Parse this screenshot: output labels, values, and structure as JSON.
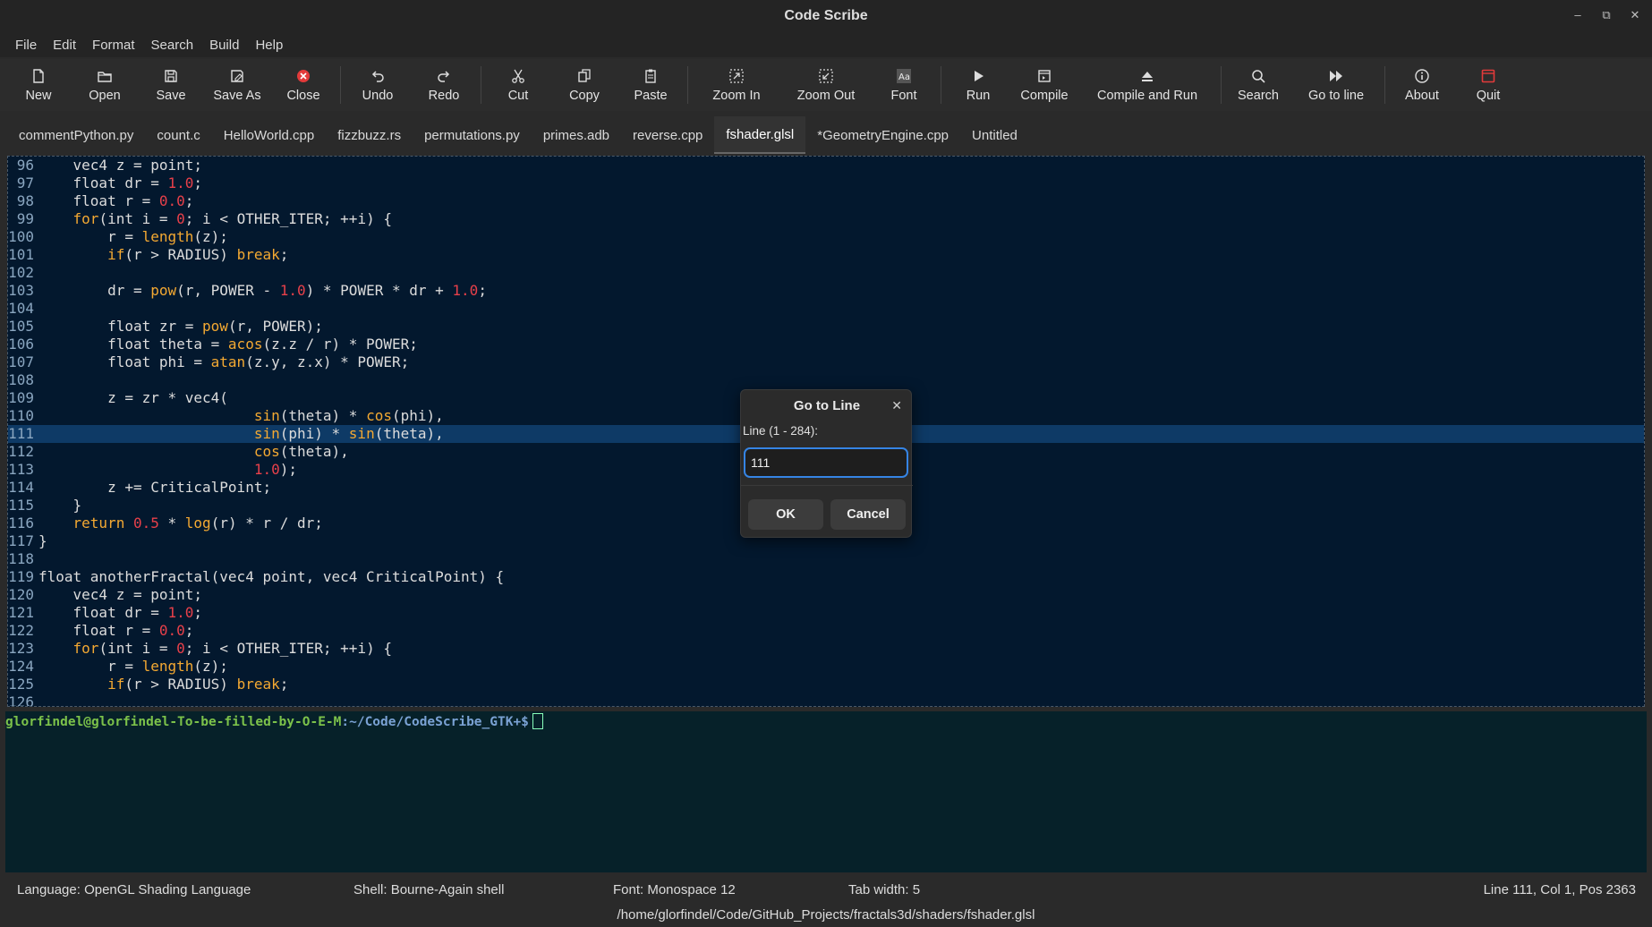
{
  "window": {
    "title": "Code Scribe"
  },
  "menu": [
    "File",
    "Edit",
    "Format",
    "Search",
    "Build",
    "Help"
  ],
  "toolbar": [
    {
      "label": "New",
      "icon": "new-file-icon"
    },
    {
      "label": "Open",
      "icon": "folder-icon"
    },
    {
      "label": "Save",
      "icon": "save-icon"
    },
    {
      "label": "Save As",
      "icon": "save-as-icon"
    },
    {
      "label": "Close",
      "icon": "close-circle-icon"
    },
    {
      "label": "Undo",
      "icon": "undo-icon"
    },
    {
      "label": "Redo",
      "icon": "redo-icon"
    },
    {
      "label": "Cut",
      "icon": "scissors-icon"
    },
    {
      "label": "Copy",
      "icon": "copy-icon"
    },
    {
      "label": "Paste",
      "icon": "clipboard-icon"
    },
    {
      "label": "Zoom In",
      "icon": "zoom-in-icon"
    },
    {
      "label": "Zoom Out",
      "icon": "zoom-out-icon"
    },
    {
      "label": "Font",
      "icon": "font-icon"
    },
    {
      "label": "Run",
      "icon": "play-icon"
    },
    {
      "label": "Compile",
      "icon": "compile-icon"
    },
    {
      "label": "Compile and Run",
      "icon": "eject-icon"
    },
    {
      "label": "Search",
      "icon": "search-icon"
    },
    {
      "label": "Go to line",
      "icon": "fast-forward-icon"
    },
    {
      "label": "About",
      "icon": "info-icon"
    },
    {
      "label": "Quit",
      "icon": "quit-icon"
    }
  ],
  "tabs": [
    {
      "label": "commentPython.py"
    },
    {
      "label": "count.c"
    },
    {
      "label": "HelloWorld.cpp"
    },
    {
      "label": "fizzbuzz.rs"
    },
    {
      "label": "permutations.py"
    },
    {
      "label": "primes.adb"
    },
    {
      "label": "reverse.cpp"
    },
    {
      "label": "fshader.glsl",
      "active": true
    },
    {
      "label": "*GeometryEngine.cpp"
    },
    {
      "label": "Untitled"
    }
  ],
  "editor": {
    "current_line": 111,
    "lines": [
      {
        "n": "96",
        "code": "    vec4 z = point;"
      },
      {
        "n": "97",
        "code": "    float dr = 1.0;"
      },
      {
        "n": "98",
        "code": "    float r = 0.0;"
      },
      {
        "n": "99",
        "code": "    for(int i = 0; i < OTHER_ITER; ++i) {"
      },
      {
        "n": "100",
        "code": "        r = length(z);"
      },
      {
        "n": "101",
        "code": "        if(r > RADIUS) break;"
      },
      {
        "n": "102",
        "code": ""
      },
      {
        "n": "103",
        "code": "        dr = pow(r, POWER - 1.0) * POWER * dr + 1.0;"
      },
      {
        "n": "104",
        "code": ""
      },
      {
        "n": "105",
        "code": "        float zr = pow(r, POWER);"
      },
      {
        "n": "106",
        "code": "        float theta = acos(z.z / r) * POWER;"
      },
      {
        "n": "107",
        "code": "        float phi = atan(z.y, z.x) * POWER;"
      },
      {
        "n": "108",
        "code": ""
      },
      {
        "n": "109",
        "code": "        z = zr * vec4("
      },
      {
        "n": "110",
        "code": "                         sin(theta) * cos(phi),"
      },
      {
        "n": "111",
        "code": "                         sin(phi) * sin(theta),"
      },
      {
        "n": "112",
        "code": "                         cos(theta),"
      },
      {
        "n": "113",
        "code": "                         1.0);"
      },
      {
        "n": "114",
        "code": "        z += CriticalPoint;"
      },
      {
        "n": "115",
        "code": "    }"
      },
      {
        "n": "116",
        "code": "    return 0.5 * log(r) * r / dr;"
      },
      {
        "n": "117",
        "code": "}"
      },
      {
        "n": "118",
        "code": ""
      },
      {
        "n": "119",
        "code": "float anotherFractal(vec4 point, vec4 CriticalPoint) {"
      },
      {
        "n": "120",
        "code": "    vec4 z = point;"
      },
      {
        "n": "121",
        "code": "    float dr = 1.0;"
      },
      {
        "n": "122",
        "code": "    float r = 0.0;"
      },
      {
        "n": "123",
        "code": "    for(int i = 0; i < OTHER_ITER; ++i) {"
      },
      {
        "n": "124",
        "code": "        r = length(z);"
      },
      {
        "n": "125",
        "code": "        if(r > RADIUS) break;"
      },
      {
        "n": "126",
        "code": ""
      }
    ]
  },
  "terminal": {
    "user": "glorfindel@glorfindel-To-be-filled-by-O-E-M",
    "path": ":~/Code/CodeScribe_GTK+$"
  },
  "status": {
    "language": "Language: OpenGL Shading Language",
    "shell": "Shell: Bourne-Again shell",
    "font": "Font: Monospace 12",
    "tab_width": "Tab width: 5",
    "position": "Line 111,  Col 1,  Pos 2363",
    "file_path": "/home/glorfindel/Code/GitHub_Projects/fractals3d/shaders/fshader.glsl"
  },
  "dialog": {
    "title": "Go to Line",
    "label": "Line (1 - 284):",
    "value": "111",
    "ok": "OK",
    "cancel": "Cancel"
  }
}
